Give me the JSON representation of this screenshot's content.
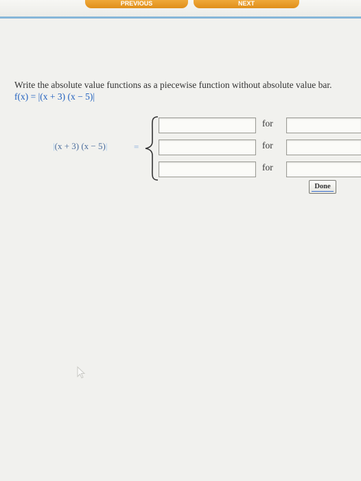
{
  "nav": {
    "previous_label": "PREVIOUS",
    "next_label": "NEXT"
  },
  "prompt": {
    "text": "Write the absolute value functions as a piecewise function without absolute value bar.",
    "function_expr": "f(x) = |(x + 3) (x − 5)|"
  },
  "piecewise": {
    "lhs": "(x + 3) (x − 5)",
    "lhs_bar": "|",
    "equals": "=",
    "rows": [
      {
        "expression_value": "",
        "for_label": "for",
        "condition_value": ""
      },
      {
        "expression_value": "",
        "for_label": "for",
        "condition_value": ""
      },
      {
        "expression_value": "",
        "for_label": "for",
        "condition_value": ""
      }
    ]
  },
  "done_button": {
    "label": "Done"
  },
  "colors": {
    "accent": "#f0a02a",
    "rule": "#86b6d8",
    "math_blue": "#1f5fbf"
  }
}
